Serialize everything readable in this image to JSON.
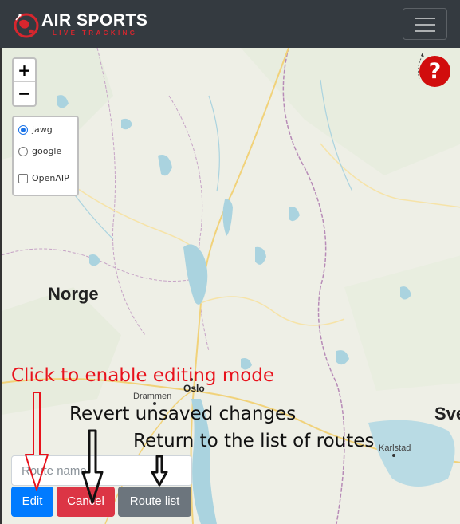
{
  "navbar": {
    "brand_title": "AIR SPORTS",
    "brand_subtitle": "LIVE TRACKING",
    "menu_icon": "hamburger-icon",
    "colors": {
      "background": "#343a40",
      "brand_accent": "#d7262e"
    }
  },
  "map": {
    "zoom_in_label": "+",
    "zoom_out_label": "−",
    "layers": {
      "base": [
        {
          "label": "jawg",
          "selected": true
        },
        {
          "label": "google",
          "selected": false
        }
      ],
      "overlays": [
        {
          "label": "OpenAIP",
          "checked": false
        }
      ]
    },
    "help_label": "?",
    "places": {
      "norge": "Norge",
      "oslo": "Oslo",
      "drammen": "Drammen",
      "karlstad": "Karlstad",
      "sverige_partial": "Sve"
    }
  },
  "annotations": {
    "edit_hint": "Click to enable editing mode",
    "cancel_hint": "Revert unsaved changes",
    "route_list_hint": "Return to the list of routes",
    "colors": {
      "edit_hint": "#e8121c",
      "other_hints": "#111111"
    }
  },
  "route_form": {
    "route_name_placeholder": "Route name",
    "route_name_value": "",
    "edit_button": "Edit",
    "cancel_button": "Cancel",
    "route_list_button": "Route list",
    "colors": {
      "edit": "#007bff",
      "cancel": "#dc3545",
      "route_list": "#6c757d"
    }
  }
}
